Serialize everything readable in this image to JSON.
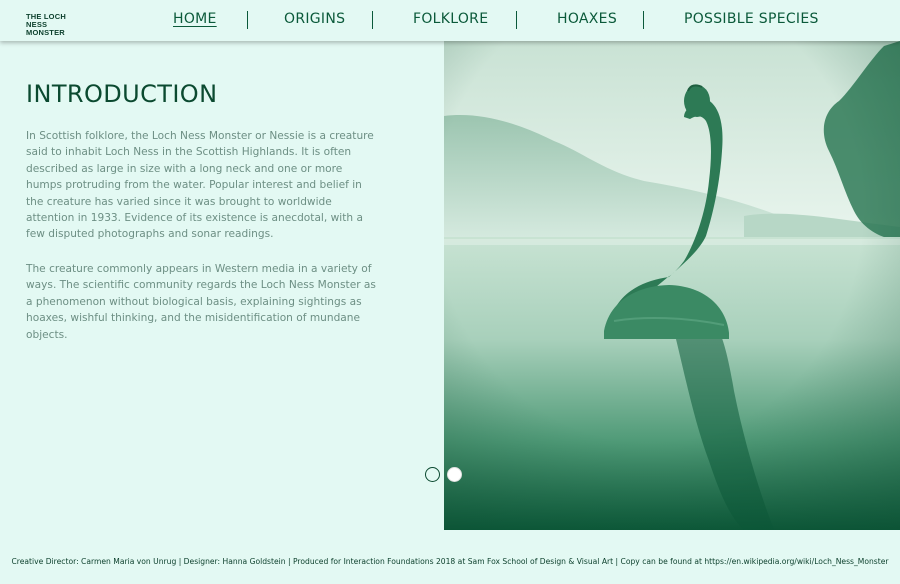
{
  "site": {
    "logo_line1": "THE LOCH NESS",
    "logo_line2": "MONSTER"
  },
  "nav": {
    "items": [
      {
        "label": "HOME",
        "active": true
      },
      {
        "label": "ORIGINS",
        "active": false
      },
      {
        "label": "FOLKLORE",
        "active": false
      },
      {
        "label": "HOAXES",
        "active": false
      },
      {
        "label": "POSSIBLE SPECIES",
        "active": false
      }
    ]
  },
  "main": {
    "heading": "INTRODUCTION",
    "paragraphs": [
      "In Scottish folklore, the Loch Ness Monster or Nessie is a creature said to inhabit Loch Ness in the Scottish Highlands. It is often described as large in size with a long neck and one or more humps protruding from the water. Popular interest and belief in the creature has varied since it was brought to worldwide attention in 1933. Evidence of its existence is anecdotal, with a few disputed photographs and sonar readings.",
      "The creature commonly appears in Western media in a variety of ways. The scientific community regards the Loch Ness Monster as a phenomenon without biological basis, explaining sightings as hoaxes, wishful thinking, and the misidentification of mundane objects."
    ]
  },
  "carousel": {
    "slide_count": 2,
    "active_index": 0
  },
  "footer": {
    "text": "Creative Director: Carmen Maria von Unrug | Designer: Hanna Goldstein | Produced for Interaction Foundations 2018 at Sam Fox School of Design & Visual Art | Copy can be found at https://en.wikipedia.org/wiki/Loch_Ness_Monster"
  },
  "colors": {
    "background": "#e3f9f3",
    "accent": "#0b5a3a",
    "body_text": "#6d8f84"
  }
}
